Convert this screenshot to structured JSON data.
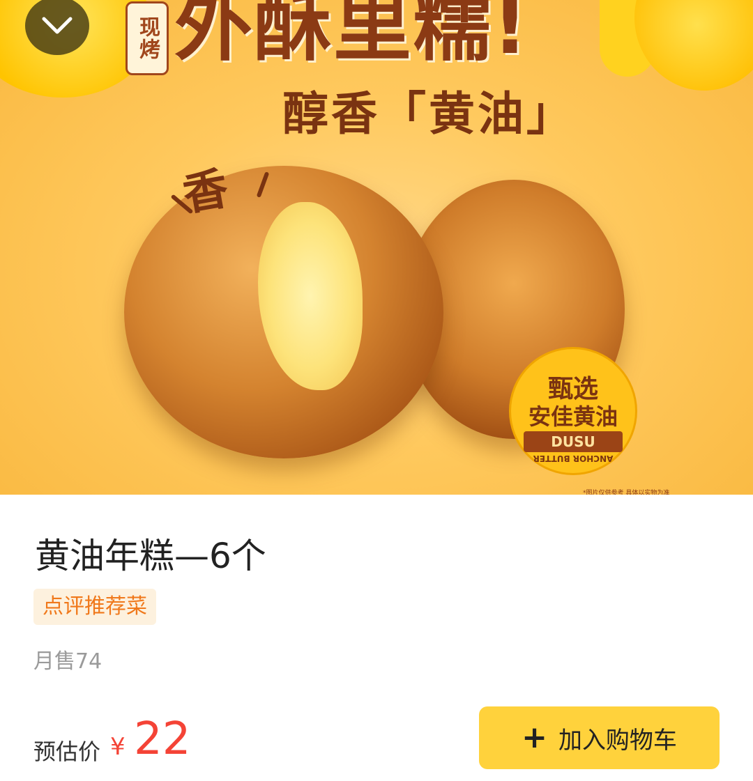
{
  "hero": {
    "tag": "现烤",
    "headline": "外酥里糯!",
    "subline": "醇香「黄油」",
    "callout": "香",
    "badge": {
      "line1": "甄选",
      "line2": "安佳黄油",
      "ribbon": "DUSU",
      "arc": "ANCHOR BUTTER"
    },
    "fineprint": "*图片仅供参考 具体以实物为准"
  },
  "icons": {
    "collapse": "chevron-down-icon",
    "add": "plus-icon"
  },
  "product": {
    "name": "黄油年糕—6个",
    "tag": "点评推荐菜",
    "monthly_sales": "月售74"
  },
  "price": {
    "label": "预估价",
    "currency": "¥",
    "value": "22"
  },
  "cart": {
    "button_label": "加入购物车"
  },
  "colors": {
    "price": "#f44336",
    "cart_button": "#ffd23c",
    "tag_text": "#f0781a",
    "tag_bg": "#fdf1de"
  }
}
